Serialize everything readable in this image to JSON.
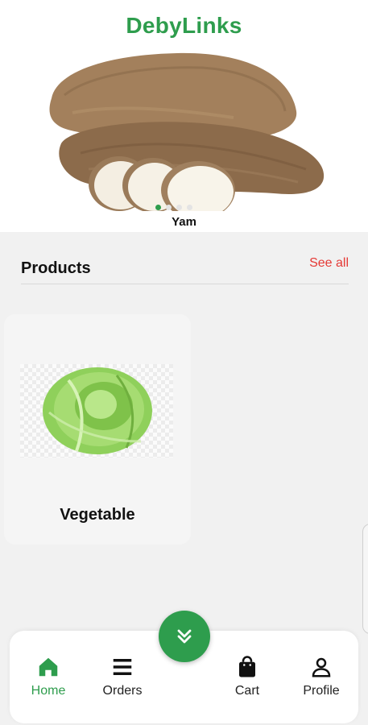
{
  "app": {
    "title": "DebyLinks"
  },
  "banner": {
    "caption": "Yam",
    "image_icon": "yam-image",
    "dots": 4,
    "active_dot": 0
  },
  "products_section": {
    "title": "Products",
    "see_all_label": "See all"
  },
  "products": [
    {
      "name": "Vegetable",
      "image_icon": "cabbage-image"
    }
  ],
  "bottom_nav": {
    "items": [
      {
        "label": "Home",
        "icon": "home-icon",
        "active": true
      },
      {
        "label": "Orders",
        "icon": "menu-icon",
        "active": false
      },
      {
        "label": "Cart",
        "icon": "shopping-bag-icon",
        "active": false
      },
      {
        "label": "Profile",
        "icon": "person-icon",
        "active": false
      }
    ],
    "fab_icon": "chevron-double-down-icon"
  },
  "colors": {
    "brand_green": "#2e9d4d",
    "see_all_red": "#e53935",
    "background": "#f1f1f1"
  }
}
